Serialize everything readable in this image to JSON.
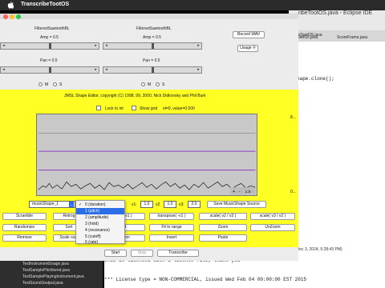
{
  "mac": {
    "app_name": "TranscribeTootOS"
  },
  "eclipse": {
    "title": "ribeTootOS.java - Eclipse IDE",
    "tabs": [
      "ribeTootOS.java",
      "oundMIDI.java",
      "ScoreFrame.java"
    ],
    "code_line": "hape.clone();",
    "console_date": "(Dec 3, 2024, 5:28:43 PM)",
    "console_line1": "JMSL is licensed with a license file, thank-you",
    "console_line2": "*** License type = NON-COMMERCIAL, issued Wed Feb 04 00:00:00 EST 2015",
    "tree_items": [
      "TestInstrumentUsage.java",
      "TestSamplePitchbend.java",
      "TestSamplePlayingInstrument.java",
      "TestSoundJoutput.java"
    ]
  },
  "filters": [
    {
      "title": "FilteredSawtoothBL",
      "amp": "Amp = 0.5",
      "pan": "Pan = 0.5",
      "amp_level": 0.5,
      "pan_level": 0.5
    },
    {
      "title": "FilteredSawtoothBL",
      "amp": "Amp = 0.5",
      "pan": "Pan = 0.5",
      "amp_level": 0.5,
      "pan_level": 0.5
    }
  ],
  "radio_labels": [
    "M",
    "S"
  ],
  "right_buttons": {
    "record": "Record WAV",
    "usage": "Usage"
  },
  "editor": {
    "header": "JMSL Shape Editor, copyright (C) 1998, 99, 2000, Nick Didkovsky and Phil Burk",
    "lock_to_int": "Lock to int",
    "show_grid": "Show grid",
    "status": "el=0, value=0.500",
    "graph_top_label": "8...",
    "graph_bottom_label": "0...",
    "graph_controls": [
      "+",
      "-",
      "1.0"
    ],
    "shape_select": "musicShape_1",
    "v1_label": "v1:",
    "v1": "1.0",
    "v2_label": "v2",
    "v2": "1.0",
    "v3_label": "v3:",
    "v3": "2.0",
    "save_source": "Save MusicShape Source"
  },
  "dropdown": {
    "items": [
      "0 (duration)",
      "1 (pitch)",
      "2 (amplitude)",
      "3 (hold)",
      "4 (resonance)",
      "5 (cutoff)",
      "6 (rate)"
    ],
    "checked_index": 0,
    "highlighted_index": 1
  },
  "tool_rows": [
    [
      "Scramble",
      "Retrog",
      "",
      "scale( v1 )",
      "transpose( -v1 )",
      "scale( v2 / v3 )",
      "scale( v3 / v2 )"
    ],
    [
      "Randomize",
      "Sort",
      "",
      "vert",
      "Fit to range",
      "Zoom",
      "UnZoom"
    ],
    [
      "Remove",
      "Scale sum",
      "",
      "election",
      "Insert",
      "Paste",
      ""
    ]
  ],
  "bottom_buttons": {
    "start": "Start",
    "stop": "Stop",
    "transcribe": "Transcribe"
  }
}
